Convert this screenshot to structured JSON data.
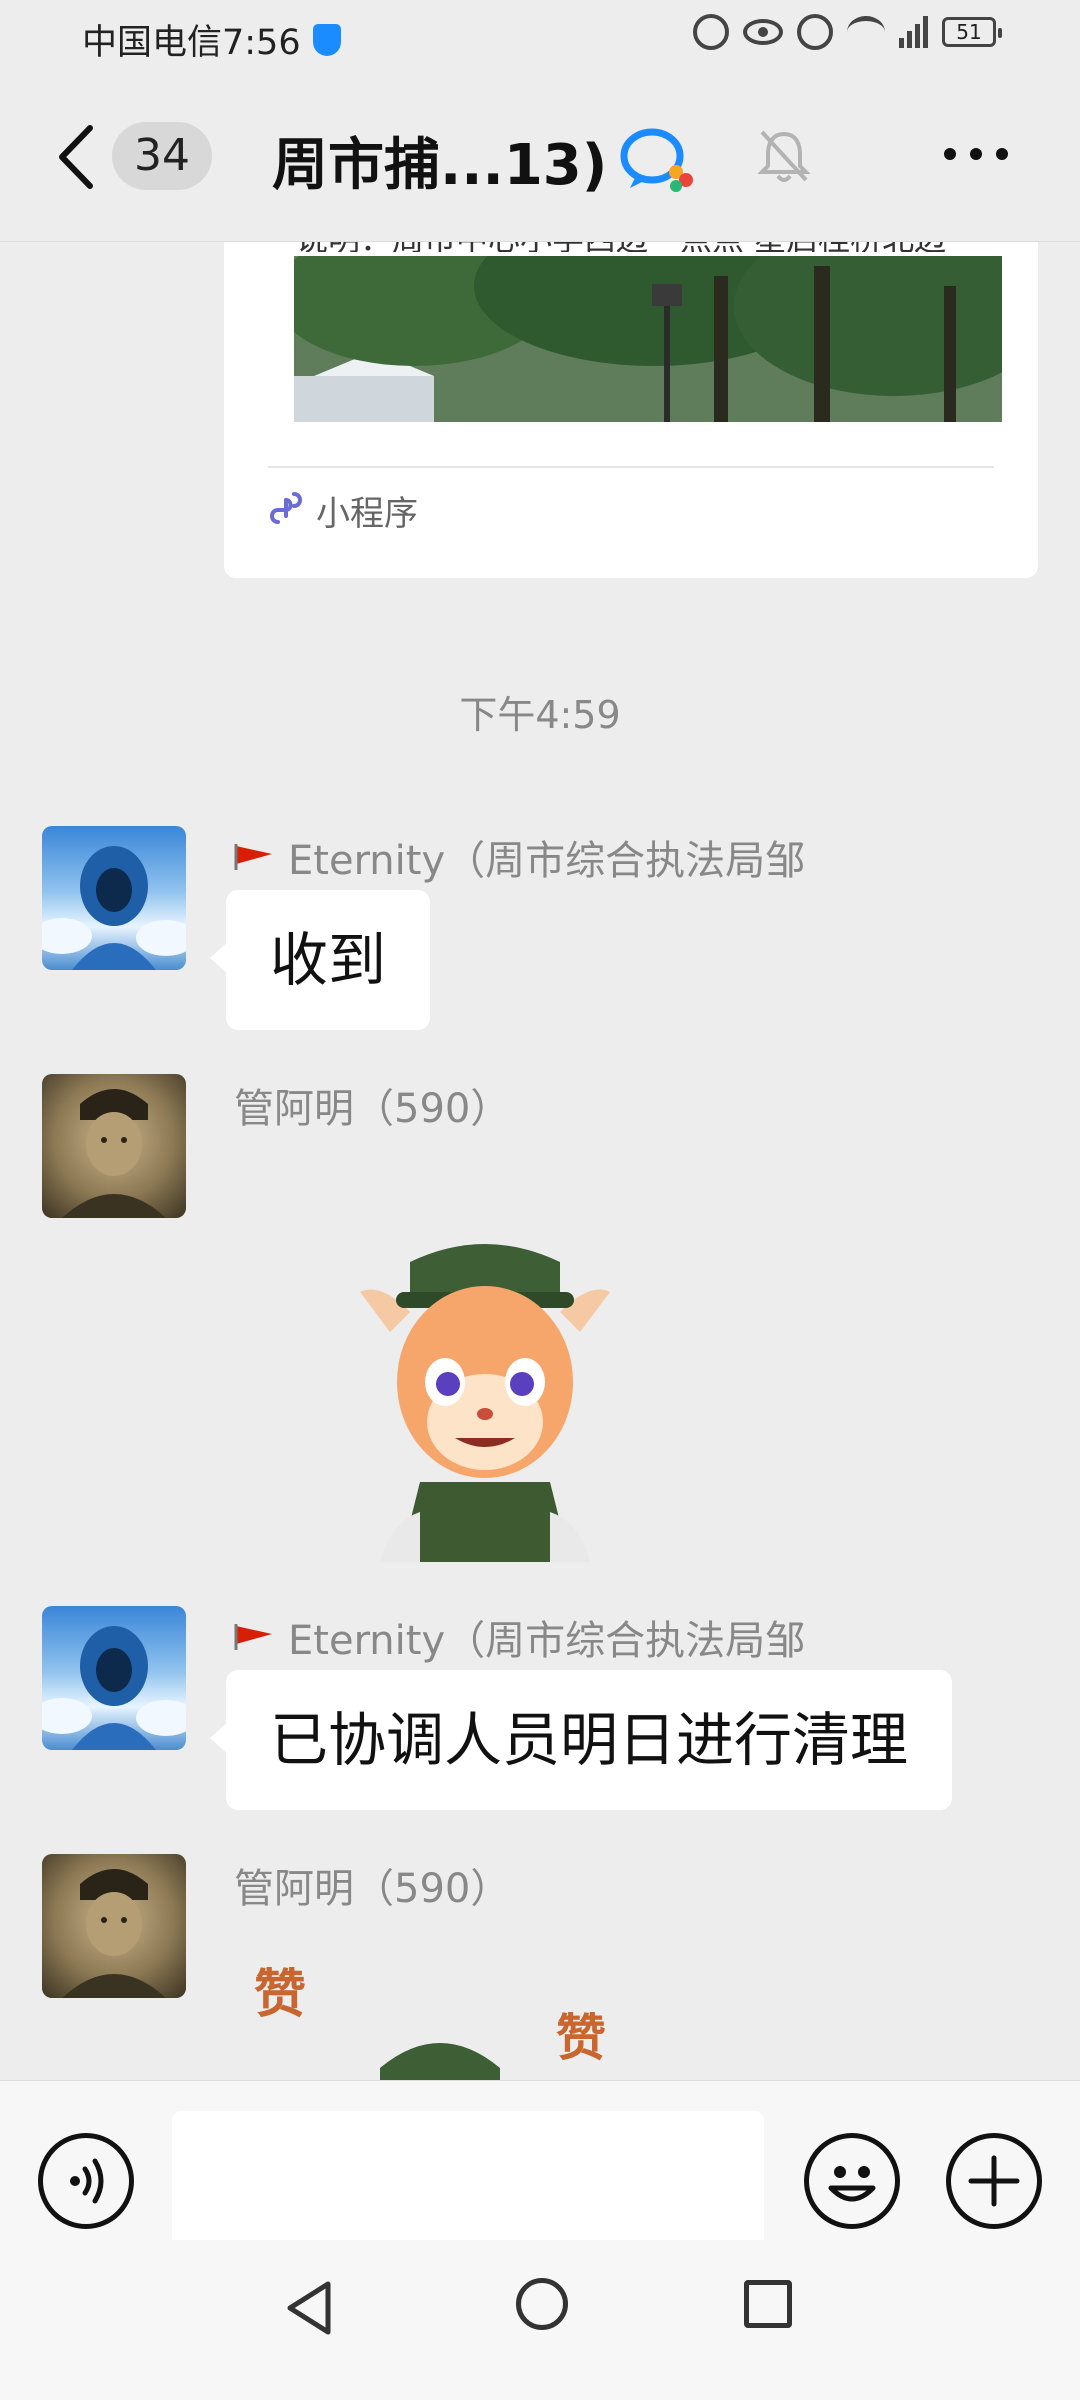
{
  "status_bar": {
    "carrier_time": "中国电信7:56",
    "battery": "51"
  },
  "nav": {
    "unread_count": "34",
    "title": "周市捕...13)"
  },
  "share_card": {
    "description": "说明：周市中心小学西边一点点 星启桂桥北边",
    "type_label": "小程序"
  },
  "timestamp": "下午4:59",
  "messages": [
    {
      "sender": "Eternity（周市综合执法局邹",
      "text": "收到",
      "avatar": "blue-hooded-figure",
      "flag": true
    },
    {
      "sender": "管阿明（590）",
      "sticker": "deer-soldier-sticker",
      "avatar": "vintage-soldier-portrait"
    },
    {
      "sender": "Eternity（周市综合执法局邹",
      "text": "已协调人员明日进行清理",
      "avatar": "blue-hooded-figure",
      "flag": true
    },
    {
      "sender": "管阿明（590）",
      "sticker": "deer-soldier-zan-sticker",
      "sticker_text": [
        "赞",
        "赞"
      ],
      "avatar": "vintage-soldier-portrait"
    }
  ],
  "colors": {
    "background": "#ededed",
    "bubble": "#ffffff",
    "flag": "#d81e06"
  }
}
